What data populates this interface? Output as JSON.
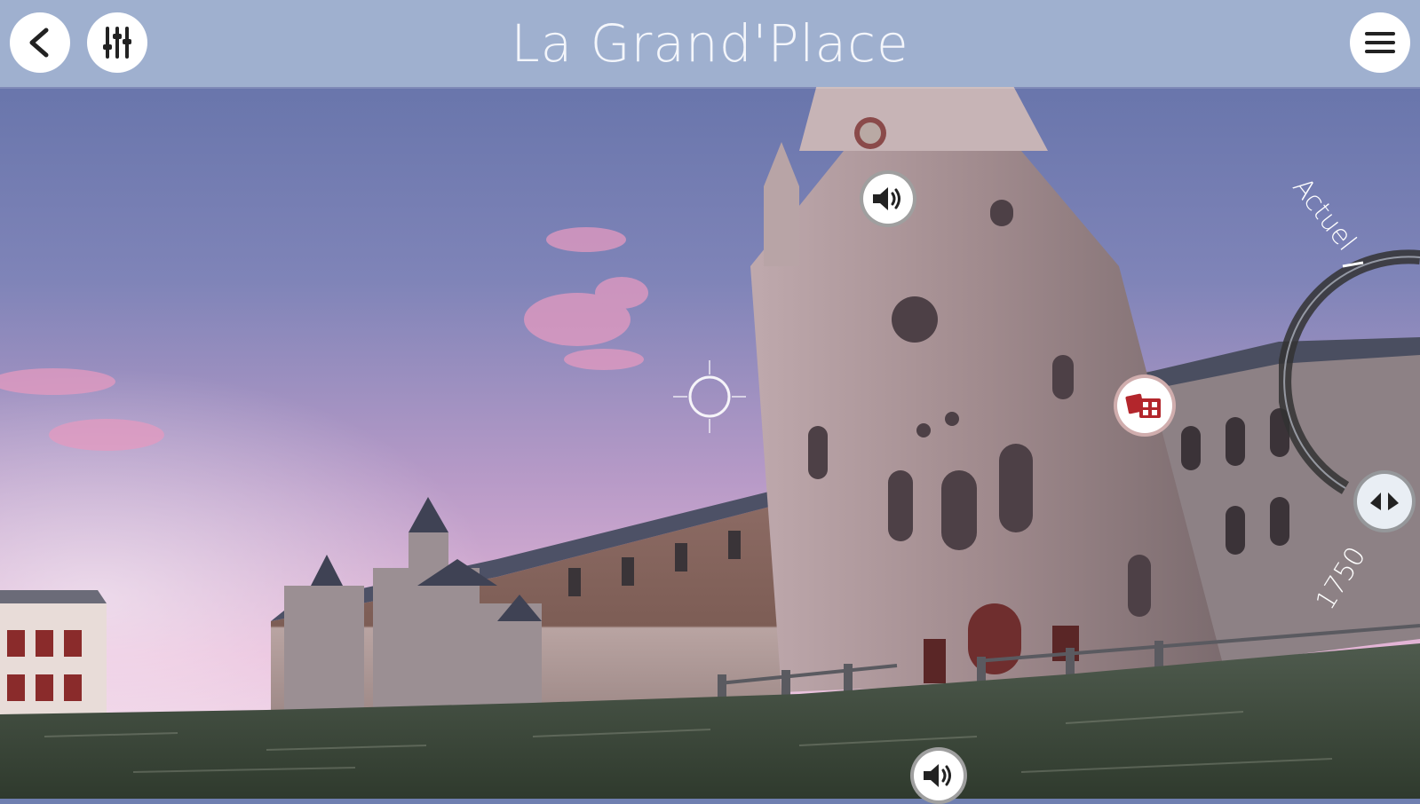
{
  "header": {
    "title": "La Grand'Place",
    "back_icon": "chevron-left-icon",
    "settings_icon": "sliders-icon",
    "menu_icon": "hamburger-menu-icon"
  },
  "hotspots": [
    {
      "id": "audio-tower",
      "icon": "speaker-icon"
    },
    {
      "id": "gallery",
      "icon": "image-gallery-icon",
      "accent": "#b3262c"
    },
    {
      "id": "audio-ground",
      "icon": "speaker-icon"
    }
  ],
  "timeline": {
    "label_top": "Actuel",
    "label_bottom": "1750",
    "handle_icon": "double-arrow-icon"
  },
  "colors": {
    "header_bg": "#9fb0cf",
    "title_text": "#f4f6fb",
    "accent_red": "#b3262c"
  }
}
